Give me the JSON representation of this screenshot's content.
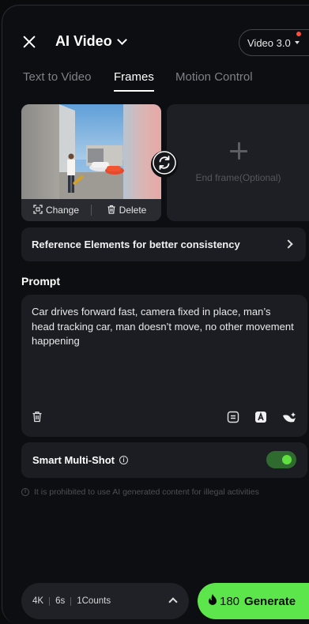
{
  "header": {
    "title": "AI Video",
    "model_label": "Video 3.0"
  },
  "tabs": [
    {
      "label": "Text to Video",
      "active": false
    },
    {
      "label": "Frames",
      "active": true
    },
    {
      "label": "Motion Control",
      "active": false
    }
  ],
  "frames": {
    "change_label": "Change",
    "delete_label": "Delete",
    "end_frame_label": "End frame(Optional)"
  },
  "reference": {
    "label": "Reference Elements for better consistency"
  },
  "prompt": {
    "label": "Prompt",
    "text": "Car drives forward fast, camera fixed in place, man’s head tracking car, man doesn’t move, no other movement happening"
  },
  "smart_multishot": {
    "label": "Smart Multi-Shot",
    "enabled": true
  },
  "notice": {
    "text": "It is prohibited to use AI generated content for illegal activities"
  },
  "bottom": {
    "resolution": "4K",
    "duration": "6s",
    "counts": "1Counts",
    "credits": "180",
    "generate_label": "Generate"
  },
  "colors": {
    "accent": "#5de64b",
    "background": "#0d0e11",
    "card": "#1c1d22",
    "toggle_on": "#2f6b2f"
  }
}
